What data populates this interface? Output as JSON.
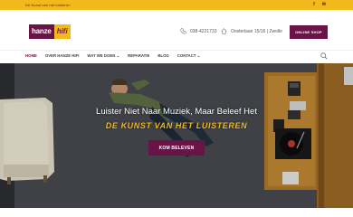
{
  "topbar": {
    "tagline": "De Kunst van het luisteren",
    "social": [
      "f",
      "✉"
    ]
  },
  "header": {
    "logo_part1": "hanze",
    "logo_part2": "hifi",
    "phone": "038-4221733",
    "address": "Oosterlaan 15/16 | Zwolle",
    "shop_button": "ONLINE SHOP"
  },
  "nav": {
    "items": [
      {
        "label": "HOME",
        "active": true
      },
      {
        "label": "OVER HANZE HIFI",
        "active": false
      },
      {
        "label": "WAT WE DOEN ⌄",
        "active": false
      },
      {
        "label": "REPARATIE",
        "active": false
      },
      {
        "label": "BLOG",
        "active": false
      },
      {
        "label": "CONTACT ⌄",
        "active": false
      }
    ],
    "search_icon": "search-icon"
  },
  "hero": {
    "headline": "Luister Niet Naar Muziek, Maar Beleef Het",
    "subline": "DE KUNST VAN HET LUISTEREN",
    "cta": "KOM BELEVEN"
  },
  "colors": {
    "accent": "#6a1346",
    "brand_yellow": "#f3b81c"
  }
}
